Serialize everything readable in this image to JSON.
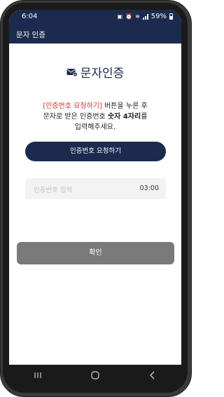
{
  "status_bar": {
    "time": "6:04",
    "battery": "59%",
    "icons": [
      "notification-icon",
      "alarm-icon",
      "wifi-icon",
      "signal-icon",
      "battery-icon"
    ]
  },
  "app_bar": {
    "title": "문자 인증"
  },
  "main": {
    "heading": "문자인증",
    "heading_icon": "message-check-icon",
    "description": {
      "line1_highlight": "[인증번호 요청하기]",
      "line1_rest": " 버튼을 누른 후",
      "line2_start": "문자로 받은 인증번호 ",
      "line2_bold": "숫자 4자리",
      "line2_end": "를",
      "line3": "입력해주세요."
    },
    "request_button_label": "인증번호 요청하기",
    "code_input": {
      "placeholder": "인증번호 입력",
      "value": "",
      "timer": "03:00"
    },
    "confirm_button_label": "확인"
  },
  "nav_bar": {
    "icons": [
      "recent-apps-icon",
      "home-icon",
      "back-icon"
    ]
  },
  "colors": {
    "primary": "#1b2a4e",
    "highlight": "#d93131",
    "disabled_button": "#7a7a7a",
    "input_bg": "#f3f3f3"
  }
}
